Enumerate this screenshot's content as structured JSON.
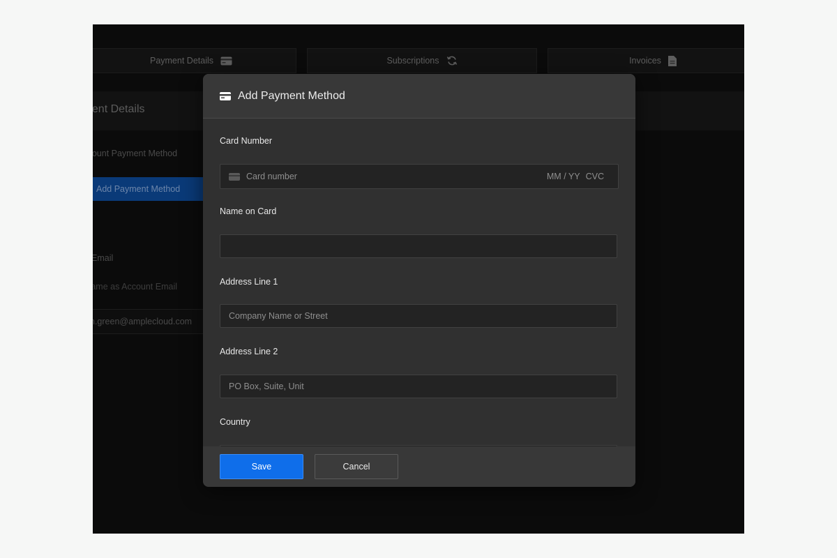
{
  "tabs": [
    {
      "label": "Payment Details",
      "icon": "credit-card-icon"
    },
    {
      "label": "Subscriptions",
      "icon": "refresh-icon"
    },
    {
      "label": "Invoices",
      "icon": "document-icon"
    }
  ],
  "background": {
    "panel_title": "Payment Details",
    "account_payment_method": "Account Payment Method",
    "add_payment_method_button": "Add Payment Method",
    "email_label": "Email",
    "same_as_account": "Same as Account Email",
    "email_value": "n.green@amplecloud.com"
  },
  "modal": {
    "title": "Add Payment Method",
    "icon": "credit-card-icon",
    "fields": {
      "card_number_label": "Card Number",
      "card_number_placeholder": "Card number",
      "card_expiry_placeholder": "MM / YY",
      "card_cvc_placeholder": "CVC",
      "name_label": "Name on Card",
      "name_value": "",
      "address1_label": "Address Line 1",
      "address1_placeholder": "Company Name or Street",
      "address2_label": "Address Line 2",
      "address2_placeholder": "PO Box, Suite, Unit",
      "country_label": "Country"
    },
    "save_label": "Save",
    "cancel_label": "Cancel"
  },
  "colors": {
    "accent": "#0f6eea",
    "modal_bg": "#303030",
    "page_bg": "#0b0b0b"
  }
}
